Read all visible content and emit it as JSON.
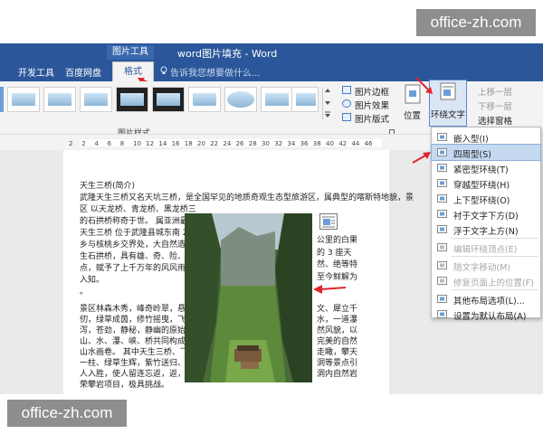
{
  "watermark": "office-zh.com",
  "titlebar": {
    "context_group": "图片工具",
    "doc_title": "word图片填充 - Word"
  },
  "tabs": [
    "开发工具",
    "百度网盘",
    "格式"
  ],
  "tell_me": "告诉我您想要做什么...",
  "ribbon": {
    "styles_group_label": "图片样式",
    "border": "图片边框",
    "effects": "图片效果",
    "layout": "图片版式",
    "position": "位置",
    "wrap_text": "环绕文字",
    "bring_forward": "上移一层",
    "send_backward": "下移一层",
    "selection_pane": "选择窗格"
  },
  "ruler_numbers": [
    "2",
    "2",
    "4",
    "6",
    "8",
    "10",
    "12",
    "14",
    "16",
    "18",
    "20",
    "22",
    "24",
    "26",
    "28",
    "30",
    "32",
    "34",
    "36",
    "38",
    "40",
    "42",
    "44",
    "46"
  ],
  "document": {
    "lines_top": [
      "天生三桥(简介)",
      "武隆天生三桥又名天坑三桥，是全国罕见的地质奇观生态型旅游区，属典型的喀斯特地貌，景",
      "区 以天龙桥、青龙桥、黑龙桥三",
      "的石拱桥称奇于世。 属亚洲最大",
      "天生三桥 位于武隆县城东南 20",
      "乡与核桃乡交界处，大自然造就",
      "生石拱桥，具有雄、奇、险、秀、",
      "点，赋予了上千万年的风风雨雨，",
      "入知。",
      "。"
    ],
    "lines_right": [
      "公里的白果",
      "的 3 座天",
      "然、绝等特",
      "至今鲜解为"
    ],
    "lines_bottom": [
      "景区林森木秀，峰奇岭翠，悬崖万",
      "仞，绿草成茵，修竹摇曳，飞泉流",
      "泻，苍劲，静秘，静幽的原始自",
      "山、水、瀑、峡、桥共同构成一幅",
      "山水画卷。 其中天生三桥、飞崖",
      "一柱、绿草生辉，紫竹送归、仙女",
      "人入胜，使人留连忘返，返，届精的",
      "荣攀岩项目，极具挑战。"
    ],
    "lines_bottom_right": [
      "文、犀立千",
      "水，一道瀑",
      "然风貌，以",
      "完美的自然",
      "走瞰，攀天",
      "洞等景点引",
      "洞内自然岩"
    ]
  },
  "wrap_menu": {
    "items": [
      {
        "label": "嵌入型(I)",
        "disabled": false,
        "highlighted": false
      },
      {
        "label": "四周型(S)",
        "disabled": false,
        "highlighted": true
      },
      {
        "label": "紧密型环绕(T)",
        "disabled": false,
        "highlighted": false
      },
      {
        "label": "穿越型环绕(H)",
        "disabled": false,
        "highlighted": false
      },
      {
        "label": "上下型环绕(O)",
        "disabled": false,
        "highlighted": false
      },
      {
        "label": "衬于文字下方(D)",
        "disabled": false,
        "highlighted": false
      },
      {
        "label": "浮于文字上方(N)",
        "disabled": false,
        "highlighted": false
      },
      {
        "label": "编辑环绕顶点(E)",
        "disabled": true,
        "highlighted": false
      },
      {
        "label": "随文字移动(M)",
        "disabled": true,
        "highlighted": false
      },
      {
        "label": "修复页面上的位置(F)",
        "disabled": true,
        "highlighted": false
      },
      {
        "label": "其他布局选项(L)...",
        "disabled": false,
        "highlighted": false
      },
      {
        "label": "设置为默认布局(A)",
        "disabled": false,
        "highlighted": false
      }
    ]
  },
  "colors": {
    "word_blue": "#2b579a",
    "arrow_red": "#e0262c",
    "menu_highlight": "#c5d9f1"
  }
}
